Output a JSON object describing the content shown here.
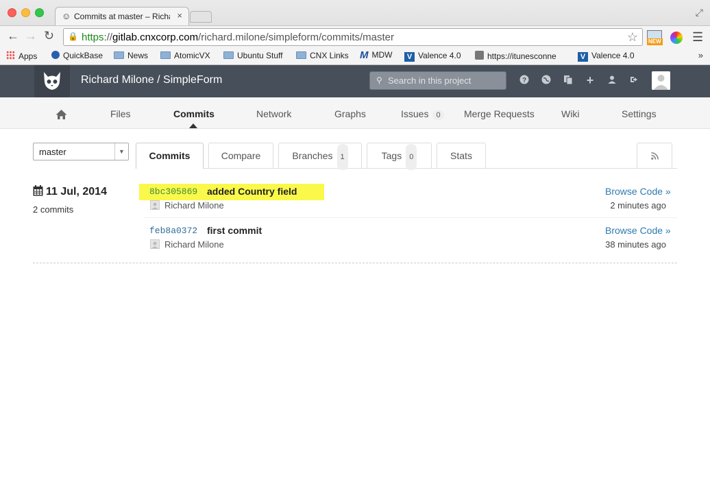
{
  "browser": {
    "tab_title": "Commits at master – Richa",
    "url_protocol": "https",
    "url_sep": "://",
    "url_host": "gitlab.cnxcorp.com",
    "url_path": "/richard.milone/simpleform/commits/master",
    "ext_badge": "NEW"
  },
  "bookmarks": [
    {
      "label": "Apps",
      "icon": "apps-grid-icon"
    },
    {
      "label": "QuickBase",
      "icon": "quickbase-icon"
    },
    {
      "label": "News",
      "icon": "folder-icon"
    },
    {
      "label": "AtomicVX",
      "icon": "folder-icon"
    },
    {
      "label": "Ubuntu Stuff",
      "icon": "folder-icon"
    },
    {
      "label": "CNX Links",
      "icon": "folder-icon"
    },
    {
      "label": "MDW",
      "icon": "mdw-icon"
    },
    {
      "label": "Valence 4.0",
      "icon": "valence-icon"
    },
    {
      "label": "https://itunesconne",
      "icon": "apple-icon"
    },
    {
      "label": "Valence 4.0",
      "icon": "valence-icon"
    }
  ],
  "header": {
    "project_title": "Richard Milone / SimpleForm",
    "search_placeholder": "Search in this project"
  },
  "project_nav": {
    "items": [
      {
        "label": "Files"
      },
      {
        "label": "Commits"
      },
      {
        "label": "Network"
      },
      {
        "label": "Graphs"
      },
      {
        "label": "Issues",
        "count": "0"
      },
      {
        "label": "Merge Requests"
      },
      {
        "label": "Wiki"
      },
      {
        "label": "Settings"
      }
    ],
    "active": "Commits"
  },
  "branch_select": {
    "value": "master"
  },
  "commit_tabs": [
    {
      "label": "Commits"
    },
    {
      "label": "Compare"
    },
    {
      "label": "Branches",
      "count": "1"
    },
    {
      "label": "Tags",
      "count": "0"
    },
    {
      "label": "Stats"
    }
  ],
  "day": {
    "date": "11 Jul, 2014",
    "count_label": "2 commits"
  },
  "commits": [
    {
      "sha": "8bc305869",
      "message": "added Country field",
      "author": "Richard Milone",
      "browse": "Browse Code »",
      "ago": "2 minutes ago"
    },
    {
      "sha": "feb8a0372",
      "message": "first commit",
      "author": "Richard Milone",
      "browse": "Browse Code »",
      "ago": "38 minutes ago"
    }
  ],
  "colors": {
    "header_bg": "#474f5a",
    "highlight": "#faf84a",
    "link": "#2e7bb0"
  }
}
